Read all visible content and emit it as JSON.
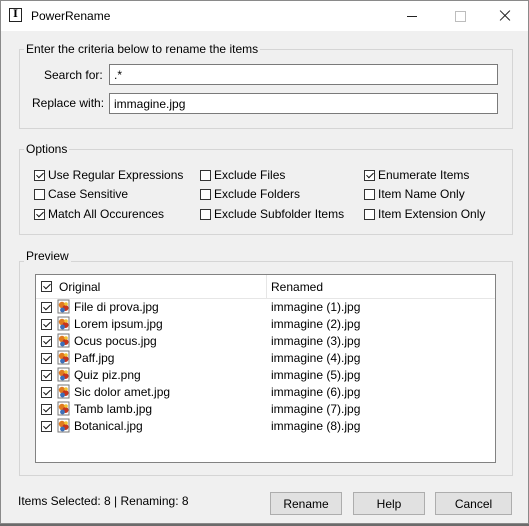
{
  "window": {
    "title": "PowerRename"
  },
  "criteria": {
    "group_title": "Enter the criteria below to rename the items",
    "search_label": "Search for:",
    "search_value": ".*",
    "replace_label": "Replace with:",
    "replace_value": "immagine.jpg"
  },
  "options": {
    "group_title": "Options",
    "items": [
      {
        "label": "Use Regular Expressions",
        "checked": true
      },
      {
        "label": "Case Sensitive",
        "checked": false
      },
      {
        "label": "Match All Occurences",
        "checked": true
      },
      {
        "label": "Exclude Files",
        "checked": false
      },
      {
        "label": "Exclude Folders",
        "checked": false
      },
      {
        "label": "Exclude Subfolder Items",
        "checked": false
      },
      {
        "label": "Enumerate Items",
        "checked": true
      },
      {
        "label": "Item Name Only",
        "checked": false
      },
      {
        "label": "Item Extension Only",
        "checked": false
      }
    ]
  },
  "preview": {
    "group_title": "Preview",
    "col_original": "Original",
    "col_renamed": "Renamed",
    "header_checked": true,
    "rows": [
      {
        "original": "File di prova.jpg",
        "renamed": "immagine (1).jpg",
        "checked": true
      },
      {
        "original": "Lorem ipsum.jpg",
        "renamed": "immagine (2).jpg",
        "checked": true
      },
      {
        "original": "Ocus pocus.jpg",
        "renamed": "immagine (3).jpg",
        "checked": true
      },
      {
        "original": "Paff.jpg",
        "renamed": "immagine (4).jpg",
        "checked": true
      },
      {
        "original": "Quiz piz.png",
        "renamed": "immagine (5).jpg",
        "checked": true
      },
      {
        "original": "Sic dolor amet.jpg",
        "renamed": "immagine (6).jpg",
        "checked": true
      },
      {
        "original": "Tamb lamb.jpg",
        "renamed": "immagine (7).jpg",
        "checked": true
      },
      {
        "original": "Botanical.jpg",
        "renamed": "immagine (8).jpg",
        "checked": true
      }
    ]
  },
  "status": {
    "text": "Items Selected: 8 | Renaming: 8"
  },
  "buttons": {
    "rename": "Rename",
    "help": "Help",
    "cancel": "Cancel"
  }
}
